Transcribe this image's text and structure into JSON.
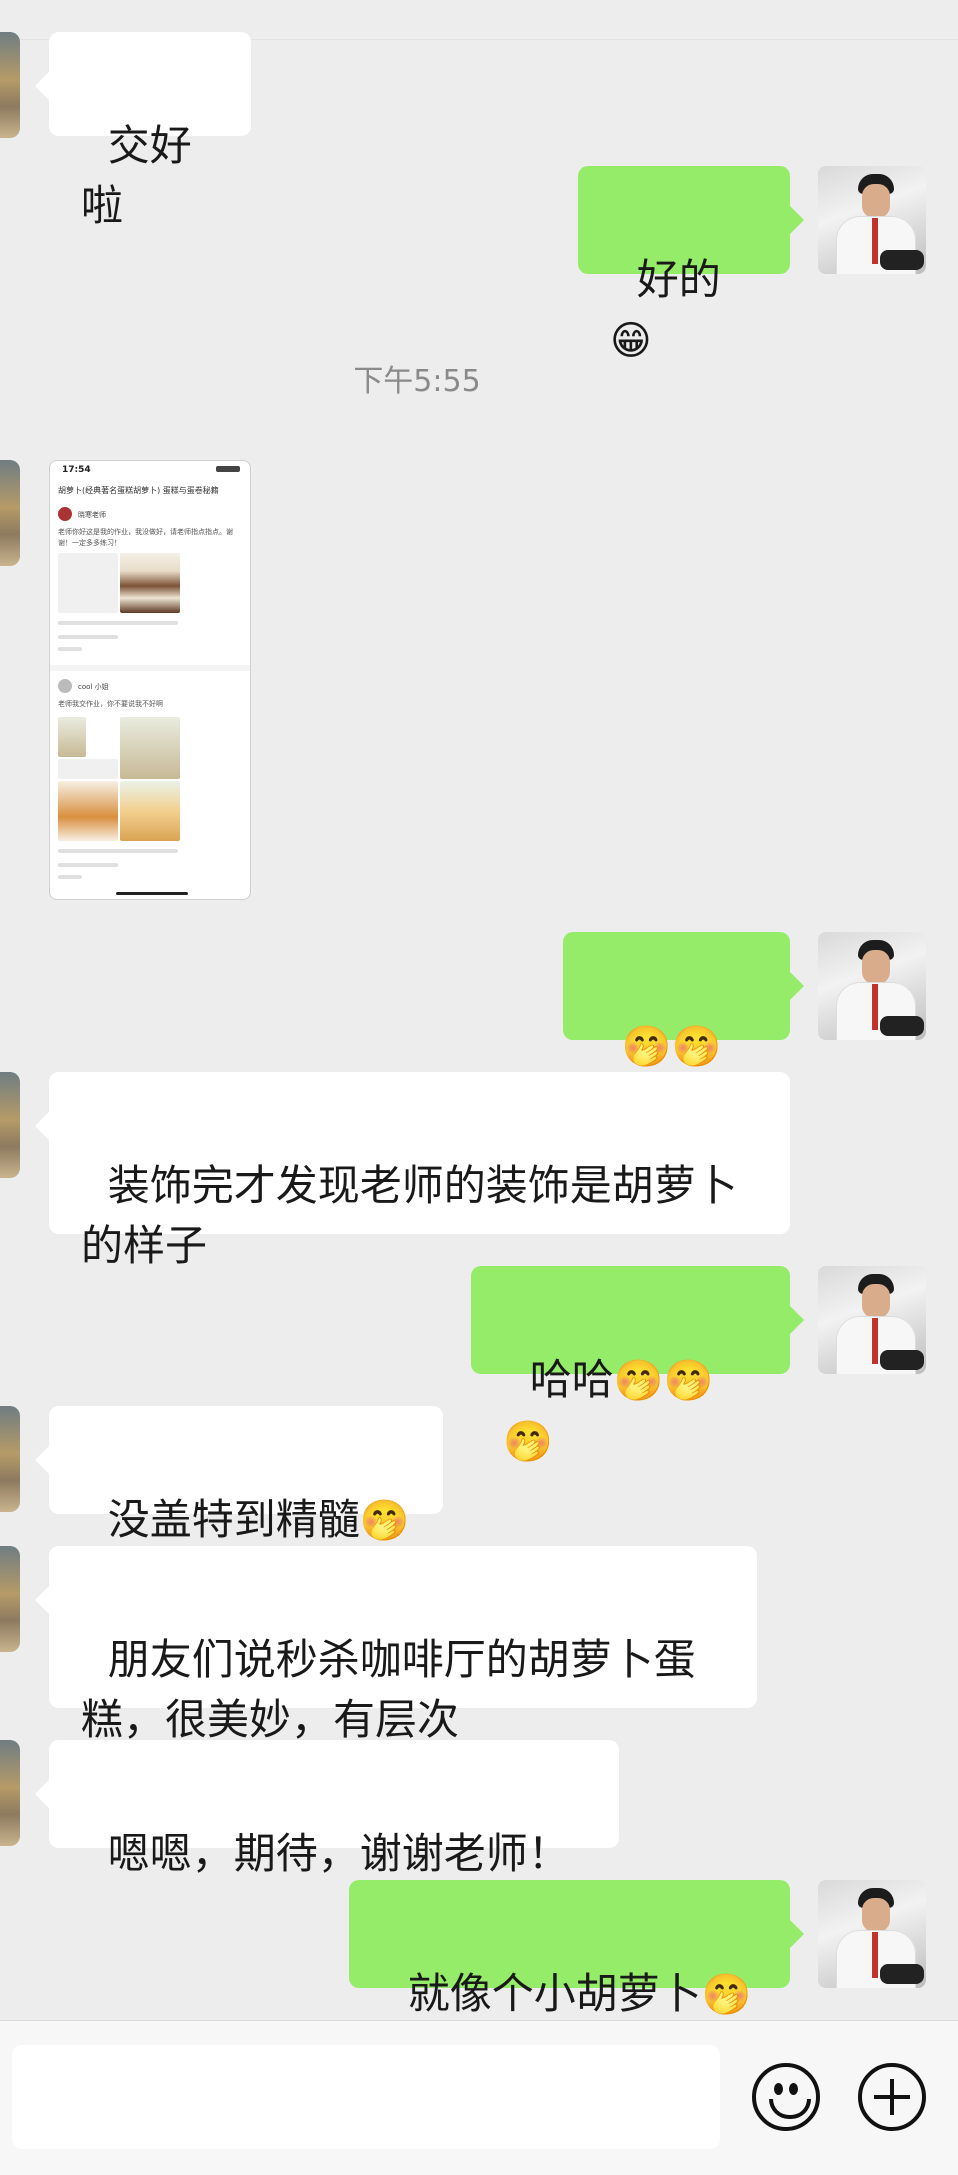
{
  "messages": [
    {
      "id": "m1",
      "side": "in",
      "text": "交好啦",
      "emoji": ""
    },
    {
      "id": "m2",
      "side": "out",
      "text": "好的",
      "emoji": "😁"
    },
    {
      "id": "m3",
      "side": "in",
      "text": "",
      "emoji": "",
      "type": "screenshot"
    },
    {
      "id": "m4",
      "side": "out",
      "text": "",
      "emoji": "🤭🤭🤭"
    },
    {
      "id": "m5",
      "side": "in",
      "text": "装饰完才发现老师的装饰是胡萝卜\n的样子",
      "emoji": ""
    },
    {
      "id": "m6",
      "side": "out",
      "text": "哈哈",
      "emoji": "🤭🤭🤭"
    },
    {
      "id": "m7",
      "side": "in",
      "text": "没盖特到精髓",
      "emoji": "🤭"
    },
    {
      "id": "m8",
      "side": "in",
      "text": "朋友们说秒杀咖啡厅的胡萝卜蛋\n糕，很美妙，有层次",
      "emoji": ""
    },
    {
      "id": "m9",
      "side": "in",
      "text": "嗯嗯，期待，谢谢老师！",
      "emoji": ""
    },
    {
      "id": "m10",
      "side": "out",
      "text": "就像个小胡萝卜",
      "emoji": "🤭"
    }
  ],
  "timestamp": "下午5:55",
  "screenshot": {
    "status_time": "17:54",
    "nav_title": "胡萝卜(经典著名蛋糕胡萝卜) 蛋糕与蛋卷秘籍",
    "post1_user": "晓寒老师",
    "post1_text": "老师你好这是我的作业，我没做好，请老师指点指点。谢谢！一定多多练习！",
    "post2_user": "cool 小姐",
    "post2_text": "老师我交作业，你不要说我不好啊"
  },
  "input": {
    "emoji_icon": "smiley-icon",
    "plus_icon": "plus-circle-icon"
  }
}
